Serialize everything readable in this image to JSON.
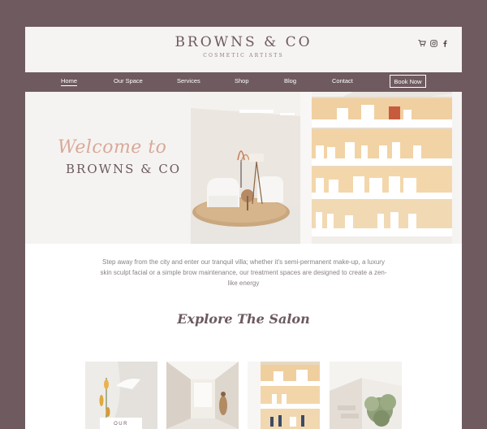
{
  "header": {
    "brand_name": "BROWNS & CO",
    "brand_tagline": "COSMETIC ARTISTS",
    "icons": [
      "cart-icon",
      "instagram-icon",
      "facebook-icon"
    ]
  },
  "nav": {
    "items": [
      {
        "label": "Home",
        "active": true
      },
      {
        "label": "Our Space"
      },
      {
        "label": "Services"
      },
      {
        "label": "Shop"
      },
      {
        "label": "Blog"
      },
      {
        "label": "Contact"
      }
    ],
    "book_label": "Book Now"
  },
  "hero": {
    "welcome": "Welcome to",
    "brand": "BROWNS & CO"
  },
  "intro": {
    "text": "Step away from the city and enter our tranquil villa; whether it's semi-permanent make-up, a luxury skin sculpt facial or a simple brow maintenance, our treatment spaces are designed to create a zen-like energy"
  },
  "explore": {
    "title": "Explore The Salon"
  },
  "tiles": [
    {
      "label": "OUR"
    },
    {
      "label": ""
    },
    {
      "label": ""
    },
    {
      "label": ""
    }
  ],
  "colors": {
    "frame": "#6e5a5f",
    "accent": "#d8a99a",
    "text": "#6b5a5e"
  }
}
